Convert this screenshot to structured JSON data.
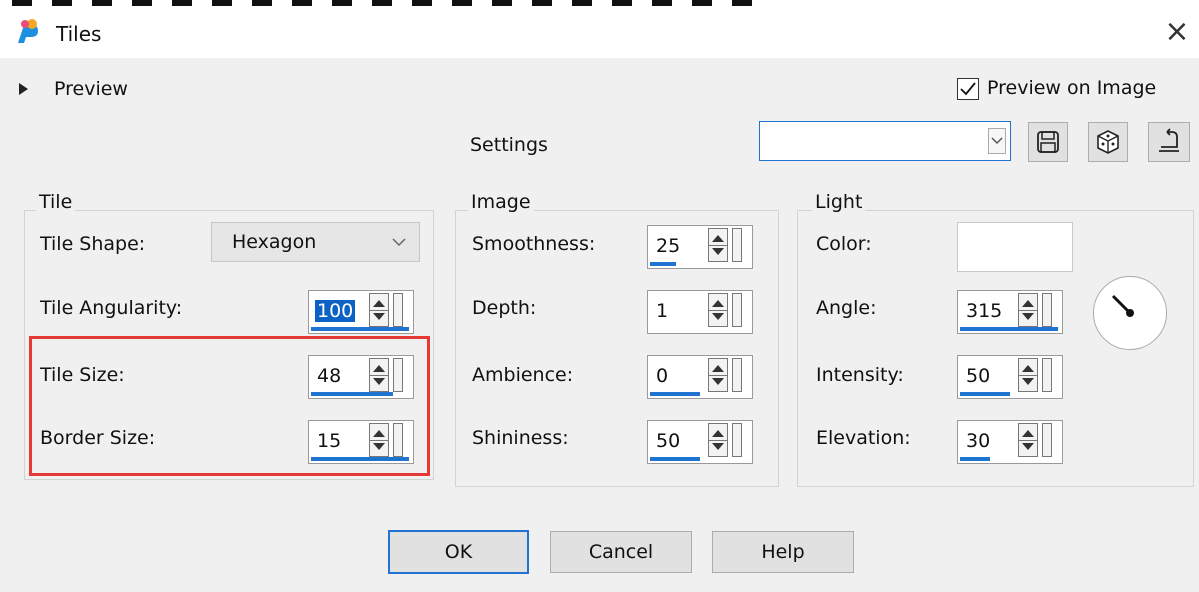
{
  "window": {
    "title": "Tiles"
  },
  "preview": {
    "toggle_label": "Preview",
    "on_image_label": "Preview on Image",
    "on_image_checked": true
  },
  "settings": {
    "label": "Settings",
    "preset_value": ""
  },
  "tile": {
    "legend": "Tile",
    "shape_label": "Tile Shape:",
    "shape_value": "Hexagon",
    "angularity_label": "Tile Angularity:",
    "angularity_value": "100",
    "size_label": "Tile Size:",
    "size_value": "48",
    "border_label": "Border Size:",
    "border_value": "15"
  },
  "image": {
    "legend": "Image",
    "smoothness_label": "Smoothness:",
    "smoothness_value": "25",
    "depth_label": "Depth:",
    "depth_value": "1",
    "ambience_label": "Ambience:",
    "ambience_value": "0",
    "shininess_label": "Shininess:",
    "shininess_value": "50"
  },
  "light": {
    "legend": "Light",
    "color_label": "Color:",
    "color_hex": "#ffffff",
    "angle_label": "Angle:",
    "angle_value": "315",
    "intensity_label": "Intensity:",
    "intensity_value": "50",
    "elevation_label": "Elevation:",
    "elevation_value": "30"
  },
  "buttons": {
    "ok": "OK",
    "cancel": "Cancel",
    "help": "Help"
  },
  "colors": {
    "accent": "#1f73d1",
    "highlight_frame": "#e53935",
    "selection": "#0b62c4"
  }
}
